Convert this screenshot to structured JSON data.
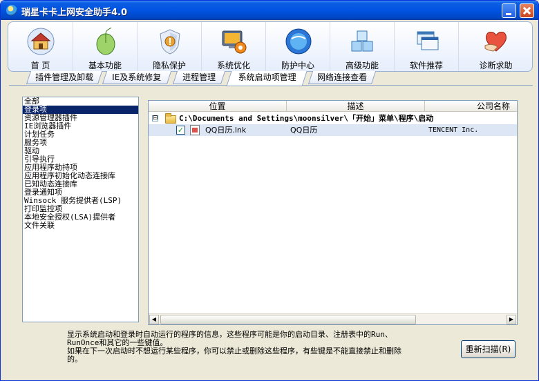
{
  "window": {
    "title": "瑞星卡卡上网安全助手4.0"
  },
  "toolbar": [
    {
      "label": "首 页",
      "icon": "home-icon"
    },
    {
      "label": "基本功能",
      "icon": "mouse-icon"
    },
    {
      "label": "隐私保护",
      "icon": "shield-icon"
    },
    {
      "label": "系统优化",
      "icon": "monitor-gear-icon"
    },
    {
      "label": "防护中心",
      "icon": "globe-icon"
    },
    {
      "label": "高级功能",
      "icon": "cubes-icon"
    },
    {
      "label": "软件推荐",
      "icon": "windows-icon"
    },
    {
      "label": "诊断求助",
      "icon": "heart-hands-icon"
    }
  ],
  "tabs": [
    "插件管理及卸载",
    "IE及系统修复",
    "进程管理",
    "系统启动项管理",
    "网络连接查看"
  ],
  "active_tab": "系统启动项管理",
  "categories": [
    "全部",
    "登录项",
    "资源管理器插件",
    "IE浏览器插件",
    "计划任务",
    "服务项",
    "驱动",
    "引导执行",
    "应用程序劫持项",
    "应用程序初始化动态连接库",
    "已知动态连接库",
    "登录通知项",
    "Winsock 服务提供者(LSP)",
    "打印监控项",
    "本地安全授权(LSA)提供者",
    "文件关联"
  ],
  "selected_category": "登录项",
  "grid": {
    "columns": [
      "位置",
      "描述",
      "公司名称"
    ],
    "folder_expander": "⊟",
    "folder_path": "C:\\Documents and Settings\\moonsilver\\「开始」菜单\\程序\\启动",
    "rows": [
      {
        "checked": true,
        "location": "QQ日历.lnk",
        "description": "QQ日历",
        "company": "TENCENT Inc."
      }
    ]
  },
  "description_lines": [
    "显示系统启动和登录时自动运行的程序的信息，这些程序可能是你的启动目录、注册表中的Run、",
    "RunOnce和其它的一些键值。",
    "如果在下一次启动时不想运行某些程序，你可以禁止或删除这些程序，有些键是不能直接禁止和删除",
    "的。"
  ],
  "buttons": {
    "rescan": "重新扫描(R)"
  },
  "colors": {
    "title_bar": "#0053e1",
    "selection": "#0a246a",
    "row_highlight": "#dce6f5"
  }
}
